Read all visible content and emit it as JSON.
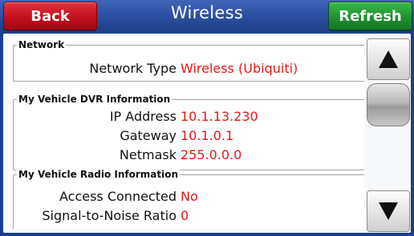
{
  "header": {
    "back_label": "Back",
    "title": "Wireless",
    "refresh_label": "Refresh"
  },
  "sections": [
    {
      "legend": "Network",
      "rows": [
        {
          "label": "Network Type",
          "value": "Wireless (Ubiquiti)"
        }
      ]
    },
    {
      "legend": "My Vehicle DVR Information",
      "rows": [
        {
          "label": "IP Address",
          "value": "10.1.13.230"
        },
        {
          "label": "Gateway",
          "value": "10.1.0.1"
        },
        {
          "label": "Netmask",
          "value": "255.0.0.0"
        }
      ]
    },
    {
      "legend": "My Vehicle Radio Information",
      "rows": [
        {
          "label": "Access Connected",
          "value": "No"
        },
        {
          "label": "Signal-to-Noise Ratio",
          "value": "0"
        }
      ]
    }
  ],
  "icons": {
    "scroll_up": "triangle-up-icon",
    "scroll_down": "triangle-down-icon"
  },
  "colors": {
    "header_blue": "#2a4f9f",
    "back_red": "#c3101c",
    "refresh_green": "#1f9230",
    "value_red": "#e11a1a"
  }
}
